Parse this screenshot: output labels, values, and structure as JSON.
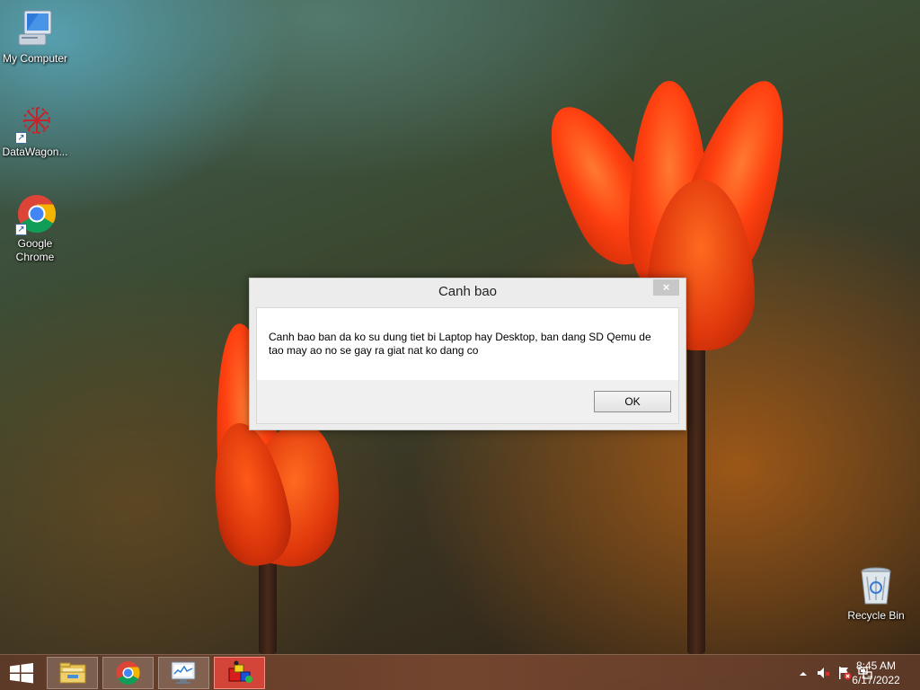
{
  "desktop": {
    "icons": [
      {
        "label": "My Computer",
        "icon": "computer-icon"
      },
      {
        "label": "DataWagon...",
        "icon": "datawagon-icon"
      },
      {
        "label": "Google Chrome",
        "icon": "chrome-icon"
      },
      {
        "label": "Recycle Bin",
        "icon": "recycle-bin-icon"
      }
    ]
  },
  "dialog": {
    "title": "Canh bao",
    "close_label": "×",
    "message": "Canh bao ban da ko su dung tiet bi Laptop hay Desktop, ban dang SD Qemu de tao may ao no se gay ra giat nat ko dang co",
    "ok_label": "OK"
  },
  "taskbar": {
    "pinned": [
      {
        "name": "file-explorer",
        "icon": "folder-icon"
      },
      {
        "name": "google-chrome",
        "icon": "chrome-icon"
      },
      {
        "name": "performance-monitor",
        "icon": "monitor-icon"
      },
      {
        "name": "running-app",
        "icon": "app-cube-icon",
        "active": true
      }
    ],
    "tray": {
      "clock_time": "8:45 AM",
      "clock_date": "6/17/2022"
    }
  },
  "colors": {
    "taskbar": "#6b4230",
    "active_task": "#e6463c",
    "dialog_bg": "#ececec"
  }
}
